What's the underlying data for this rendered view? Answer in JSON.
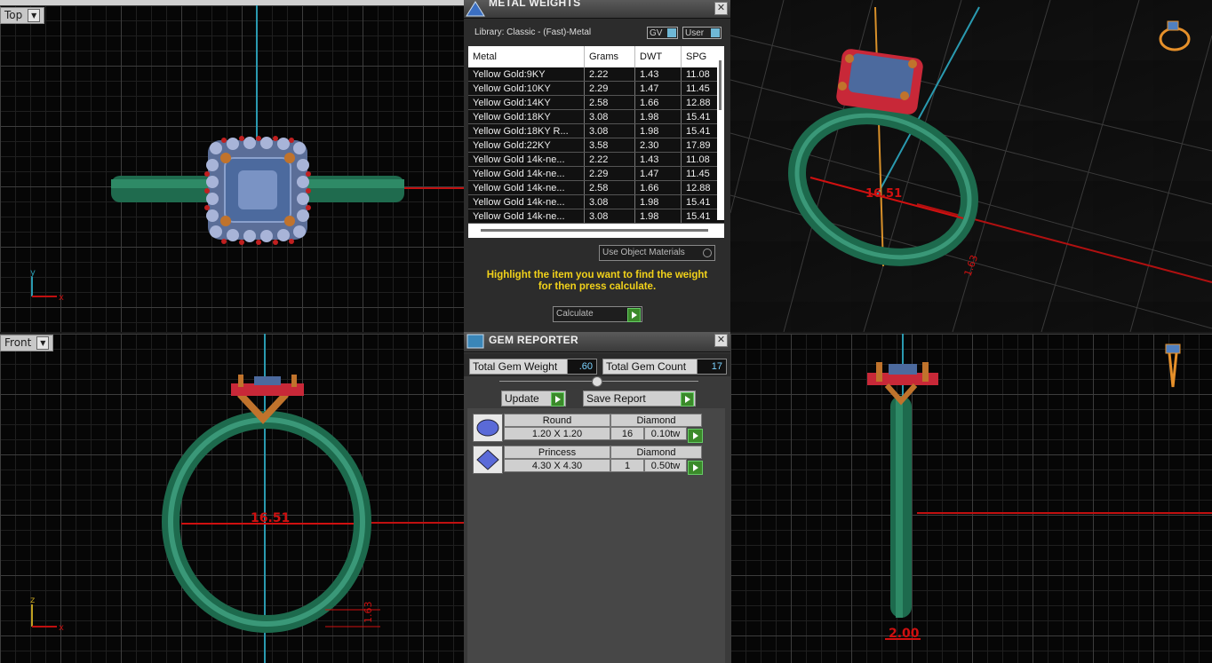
{
  "top_strip": {
    "label": "Top"
  },
  "viewports": {
    "top": {
      "label": "Top",
      "axis_a": "y",
      "axis_b": "x"
    },
    "front": {
      "label": "Front",
      "axis_a": "z",
      "axis_b": "x",
      "dimension": "16.51",
      "dimension2": "1.63"
    },
    "perspective": {
      "dimension": "16.51",
      "dimension2": "1.63"
    },
    "right": {
      "dimension": "2.00"
    }
  },
  "metal_weights": {
    "title": "METAL WEIGHTS",
    "library": "Library: Classic - (Fast)-Metal",
    "toggle_gv": "GV",
    "toggle_user": "User",
    "columns": [
      "Metal",
      "Grams",
      "DWT",
      "SPG"
    ],
    "rows": [
      [
        "Yellow Gold:9KY",
        "2.22",
        "1.43",
        "11.08"
      ],
      [
        "Yellow Gold:10KY",
        "2.29",
        "1.47",
        "11.45"
      ],
      [
        "Yellow Gold:14KY",
        "2.58",
        "1.66",
        "12.88"
      ],
      [
        "Yellow Gold:18KY",
        "3.08",
        "1.98",
        "15.41"
      ],
      [
        "Yellow Gold:18KY R...",
        "3.08",
        "1.98",
        "15.41"
      ],
      [
        "Yellow Gold:22KY",
        "3.58",
        "2.30",
        "17.89"
      ],
      [
        "Yellow Gold 14k-ne...",
        "2.22",
        "1.43",
        "11.08"
      ],
      [
        "Yellow Gold 14k-ne...",
        "2.29",
        "1.47",
        "11.45"
      ],
      [
        "Yellow Gold 14k-ne...",
        "2.58",
        "1.66",
        "12.88"
      ],
      [
        "Yellow Gold 14k-ne...",
        "3.08",
        "1.98",
        "15.41"
      ],
      [
        "Yellow Gold 14k-ne...",
        "3.08",
        "1.98",
        "15.41"
      ]
    ],
    "use_object_materials": "Use Object Materials",
    "hint": "Highlight the item you want to find the weight for then press calculate.",
    "calculate": "Calculate"
  },
  "gem_reporter": {
    "title": "GEM REPORTER",
    "total_weight_label": "Total Gem Weight",
    "total_weight": ".60",
    "total_count_label": "Total Gem Count",
    "total_count": "17",
    "update": "Update",
    "save_report": "Save Report",
    "gems": [
      {
        "shape": "Round",
        "size": "1.20 X 1.20",
        "material": "Diamond",
        "count": "16",
        "weight": "0.10tw"
      },
      {
        "shape": "Princess",
        "size": "4.30 X 4.30",
        "material": "Diamond",
        "count": "1",
        "weight": "0.50tw"
      }
    ]
  }
}
